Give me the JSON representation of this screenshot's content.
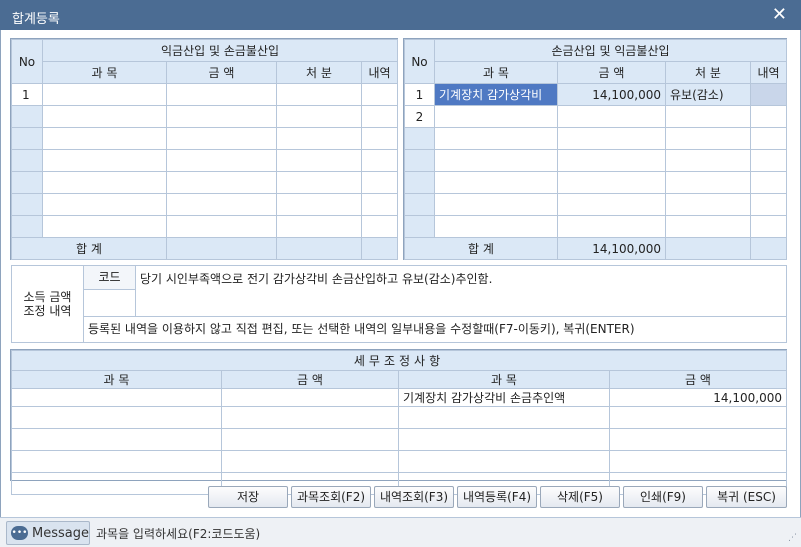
{
  "window": {
    "title": "합계등록"
  },
  "left_table": {
    "no_header": "No",
    "group_header": "익금산입 및 손금불산입",
    "columns": [
      "과  목",
      "금  액",
      "처  분",
      "내역"
    ],
    "rows": [
      {
        "no": "1",
        "subject": "",
        "amount": "",
        "disposal": "",
        "detail": ""
      }
    ],
    "empty_rows": 6,
    "total_label": "합  계",
    "total_amount": ""
  },
  "right_table": {
    "no_header": "No",
    "group_header": "손금산입 및 익금불산입",
    "columns": [
      "과  목",
      "금  액",
      "처  분",
      "내역"
    ],
    "rows": [
      {
        "no": "1",
        "subject": "기계장치 감가상각비",
        "amount": "14,100,000",
        "disposal": "유보(감소)",
        "detail": ""
      },
      {
        "no": "2",
        "subject": "",
        "amount": "",
        "disposal": "",
        "detail": ""
      }
    ],
    "empty_rows": 5,
    "total_label": "합  계",
    "total_amount": "14,100,000"
  },
  "adjustment": {
    "label_line1": "소득 금액",
    "label_line2": "조정 내역",
    "code_header": "코드",
    "description": "당기 시인부족액으로 전기 감가상각비 손금산입하고 유보(감소)추인함.",
    "hint": "등록된 내역을 이용하지 않고 직접 편집, 또는 선택한 내역의 일부내용을 수정할때(F7-이동키), 복귀(ENTER)"
  },
  "tax_table": {
    "title": "세무조정사항",
    "columns": [
      "과      목",
      "금      액",
      "과      목",
      "금      액"
    ],
    "rows": [
      {
        "subject1": "",
        "amount1": "",
        "subject2": "기계장치 감가상각비 손금추인액",
        "amount2": "14,100,000"
      }
    ],
    "empty_rows": 4
  },
  "buttons": [
    {
      "name": "save-button",
      "label": "저장"
    },
    {
      "name": "subject-lookup-button",
      "label": "과목조회(F2)"
    },
    {
      "name": "detail-lookup-button",
      "label": "내역조회(F3)"
    },
    {
      "name": "detail-register-button",
      "label": "내역등록(F4)"
    },
    {
      "name": "delete-button",
      "label": "삭제(F5)"
    },
    {
      "name": "print-button",
      "label": "인쇄(F9)"
    },
    {
      "name": "return-button",
      "label": "복귀 (ESC)"
    }
  ],
  "status": {
    "message_label": "Message",
    "text": "과목을 입력하세요(F2:코드도움)"
  }
}
